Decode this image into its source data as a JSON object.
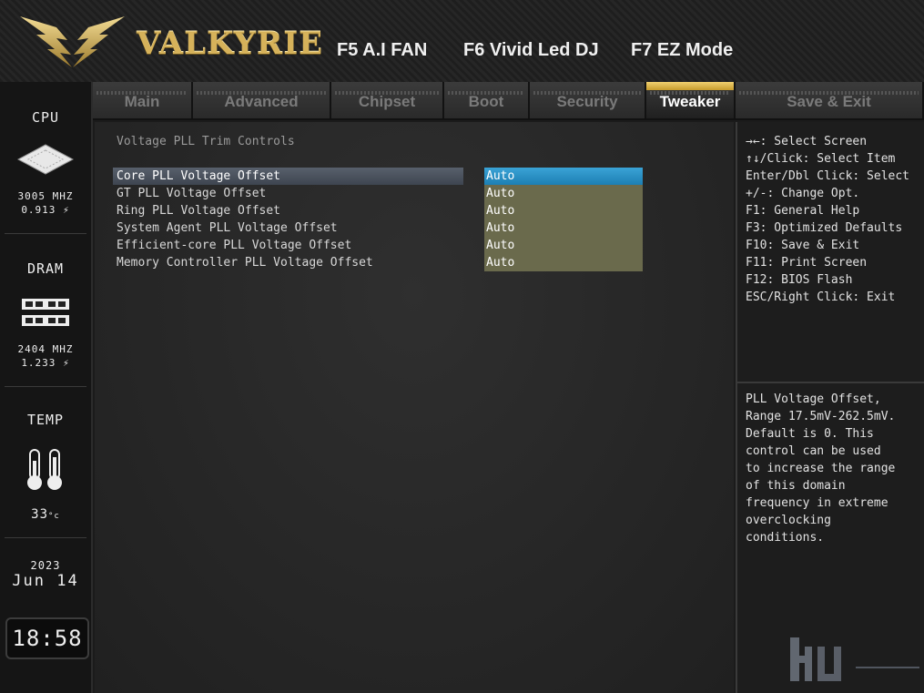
{
  "header": {
    "brand": "VALKYRIE",
    "fkeys": [
      "F5 A.I FAN",
      "F6 Vivid Led DJ",
      "F7 EZ Mode"
    ]
  },
  "sidebar": {
    "cpu": {
      "title": "CPU",
      "freq": "3005 MHZ",
      "volt": "0.913"
    },
    "dram": {
      "title": "DRAM",
      "freq": "2404 MHZ",
      "volt": "1.233"
    },
    "temp": {
      "title": "TEMP",
      "value": "33"
    },
    "date": {
      "year": "2023",
      "day": "Jun 14"
    },
    "clock": "18:58"
  },
  "tabs": [
    {
      "label": "Main"
    },
    {
      "label": "Advanced"
    },
    {
      "label": "Chipset"
    },
    {
      "label": "Boot"
    },
    {
      "label": "Security"
    },
    {
      "label": "Tweaker"
    },
    {
      "label": "Save & Exit"
    }
  ],
  "active_tab": "Tweaker",
  "main": {
    "section_title": "Voltage PLL Trim Controls",
    "rows": [
      {
        "label": "Core PLL Voltage Offset",
        "value": "Auto"
      },
      {
        "label": "GT PLL Voltage Offset",
        "value": "Auto"
      },
      {
        "label": "Ring PLL Voltage Offset",
        "value": "Auto"
      },
      {
        "label": "System Agent PLL Voltage Offset",
        "value": "Auto"
      },
      {
        "label": "Efficient-core PLL Voltage Offset",
        "value": "Auto"
      },
      {
        "label": "Memory Controller PLL Voltage Offset",
        "value": "Auto"
      }
    ]
  },
  "right": {
    "keys": [
      "→←: Select Screen",
      "↑↓/Click: Select Item",
      "Enter/Dbl Click: Select",
      "+/-: Change Opt.",
      "F1: General Help",
      "F3: Optimized Defaults",
      "F10: Save & Exit",
      "F11: Print Screen",
      "F12: BIOS Flash",
      "ESC/Right Click: Exit"
    ],
    "help": "PLL Voltage Offset,\nRange 17.5mV-262.5mV.\nDefault is 0. This\ncontrol can be used\nto increase the range\nof this domain\nfrequency in extreme\noverclocking\nconditions."
  },
  "colors": {
    "accent_gold": "#d6b25a",
    "selected_value": "#2a90c5",
    "value_bg": "#6a6a4c"
  }
}
